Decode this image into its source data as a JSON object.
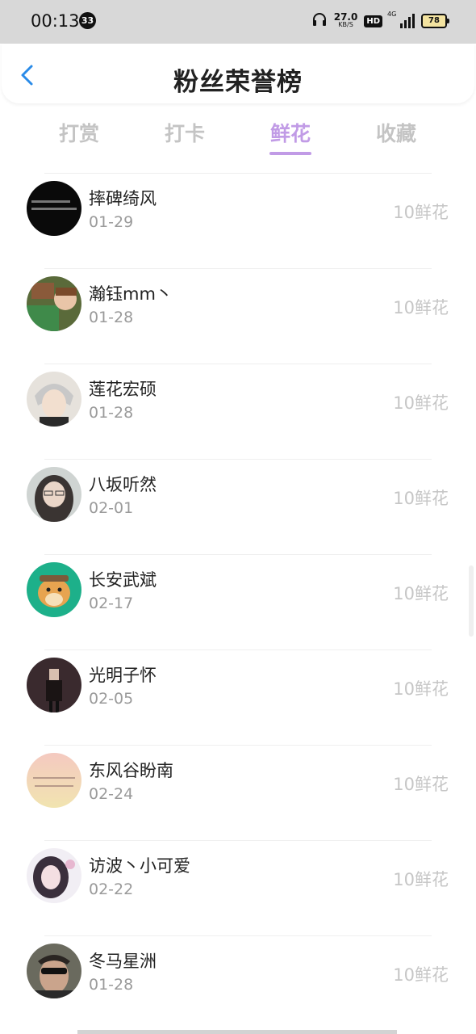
{
  "status_bar": {
    "time": "00:13",
    "notification_count": "33",
    "net_speed_value": "27.0",
    "net_speed_unit": "KB/S",
    "hd_label": "HD",
    "network_label": "4G",
    "battery_level": "78"
  },
  "header": {
    "title": "粉丝荣誉榜",
    "back_icon": "chevron-left-icon",
    "accent_color": "#2a8be8"
  },
  "tabs": [
    {
      "label": "打赏",
      "active": false
    },
    {
      "label": "打卡",
      "active": false
    },
    {
      "label": "鲜花",
      "active": true
    },
    {
      "label": "收藏",
      "active": false
    }
  ],
  "active_tab_color": "#c19be6",
  "fans": [
    {
      "name": "摔碑绮风",
      "date": "01-29",
      "amount": "10鲜花"
    },
    {
      "name": "瀚钰mm丶",
      "date": "01-28",
      "amount": "10鲜花"
    },
    {
      "name": "莲花宏硕",
      "date": "01-28",
      "amount": "10鲜花"
    },
    {
      "name": "八坂听然",
      "date": "02-01",
      "amount": "10鲜花"
    },
    {
      "name": "长安武斌",
      "date": "02-17",
      "amount": "10鲜花"
    },
    {
      "name": "光明子怀",
      "date": "02-05",
      "amount": "10鲜花"
    },
    {
      "name": "东风谷盼南",
      "date": "02-24",
      "amount": "10鲜花"
    },
    {
      "name": "访波丶小可爱",
      "date": "02-22",
      "amount": "10鲜花"
    },
    {
      "name": "冬马星洲",
      "date": "01-28",
      "amount": "10鲜花"
    }
  ]
}
